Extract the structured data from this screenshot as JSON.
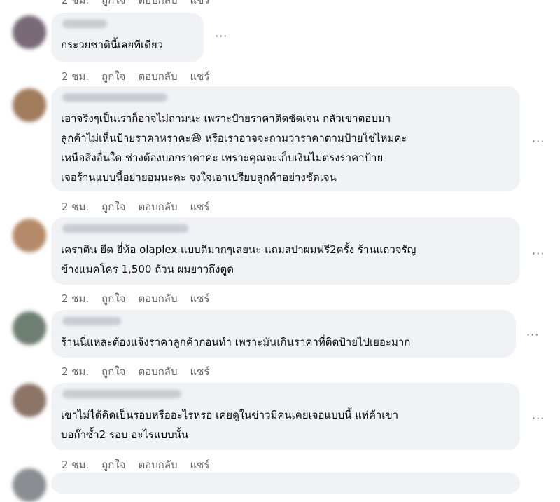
{
  "actions": {
    "time": "2 ชม.",
    "like": "ถูกใจ",
    "reply": "ตอบกลับ",
    "share": "แชร์"
  },
  "more_glyph": "···",
  "comments": [
    {
      "text": "กระวยชาตินี้เลยทีเดียว",
      "avatar_color": "#7a6a78"
    },
    {
      "text": "เอาจริงๆเป็นเราก็อาจไม่ถามนะ เพราะป้ายราคาติดชัดเจน กลัวเขาตอบมา\nลูกค้าไม่เห็นป้ายราคาหราคะ😆 หรือเราอาจจะถามว่าราคาตามป้ายใช่ไหมคะ\nเหนือสิ่งอื่นใด ช่างต้องบอกราคาค่ะ เพราะคุณจะเก็บเงินไม่ตรงราคาป้าย\nเจอร้านแบบนี้อย่ายอมนะคะ จงใจเอาเปรียบลูกค้าอย่างชัดเจน",
      "avatar_color": "#a07b5c"
    },
    {
      "text": "เคราติน ยืด ยี่ห้อ olaplex แบบดีมากๆเลยนะ แถมสปาผมฟรี2ครั้ง ร้านแถวจรัญ\nข้างแมคโคร 1,500 ถ้วน ผมยาวถึงตูด",
      "avatar_color": "#b58a6a"
    },
    {
      "text": "ร้านนี่แหละต้องแจ้งราคาลูกค้าก่อนทำ เพราะมันเกินราคาที่ติดป้ายไปเยอะมาก",
      "avatar_color": "#6f7f72"
    },
    {
      "text": "เขาไม่ได้คิดเป็นรอบหรืออะไรหรอ เคยดูในข่าวมีคนเคยเจอแบบนี้ แท่ค้าเขา\nบอก๊าซ้ำ2 รอบ อะไรแบบนั้น",
      "avatar_color": "#8c7466"
    }
  ]
}
